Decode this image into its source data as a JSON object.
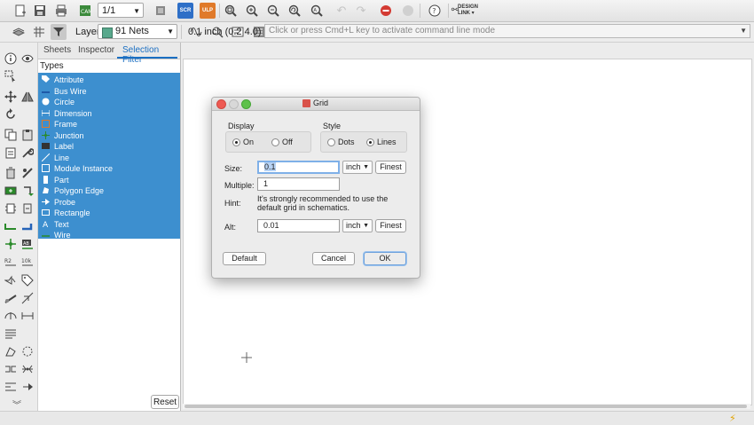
{
  "toolbar": {
    "sheet_value": "1/1",
    "scr_badge": "SCR",
    "ulp_badge": "ULP",
    "design_link_line1": "DESIGN",
    "design_link_line2": "LINK ▾"
  },
  "layer": {
    "label": "Layer:",
    "value": "91 Nets",
    "color": "#58a88c"
  },
  "coords": "0.1 inch (0.2 4.0)",
  "command_line": {
    "placeholder": "Click or press Cmd+L key to activate command line mode"
  },
  "panel": {
    "tabs": [
      "Sheets",
      "Inspector",
      "Selection Filter"
    ],
    "active_tab": "Selection Filter",
    "types_title": "Types",
    "types": [
      {
        "label": "Attribute",
        "icon": "tag-icon"
      },
      {
        "label": "Bus Wire",
        "icon": "bus-wire-icon"
      },
      {
        "label": "Circle",
        "icon": "circle-icon"
      },
      {
        "label": "Dimension",
        "icon": "dimension-icon"
      },
      {
        "label": "Frame",
        "icon": "frame-icon"
      },
      {
        "label": "Junction",
        "icon": "junction-icon"
      },
      {
        "label": "Label",
        "icon": "label-icon"
      },
      {
        "label": "Line",
        "icon": "line-icon"
      },
      {
        "label": "Module Instance",
        "icon": "module-icon"
      },
      {
        "label": "Part",
        "icon": "part-icon"
      },
      {
        "label": "Polygon Edge",
        "icon": "polygon-icon"
      },
      {
        "label": "Probe",
        "icon": "probe-icon"
      },
      {
        "label": "Rectangle",
        "icon": "rectangle-icon"
      },
      {
        "label": "Text",
        "icon": "text-icon"
      },
      {
        "label": "Wire",
        "icon": "wire-icon"
      }
    ],
    "reset_label": "Reset"
  },
  "dialog": {
    "title": "Grid",
    "display_title": "Display",
    "display_options": [
      "On",
      "Off"
    ],
    "display_selected": "On",
    "style_title": "Style",
    "style_options": [
      "Dots",
      "Lines"
    ],
    "style_selected": "Lines",
    "size_label": "Size:",
    "size_value": "0.1",
    "size_unit": "inch",
    "multiple_label": "Multiple:",
    "multiple_value": "1",
    "hint_label": "Hint:",
    "hint_text": "It's strongly recommended to use the default grid in schematics.",
    "alt_label": "Alt:",
    "alt_value": "0.01",
    "alt_unit": "inch",
    "finest_label": "Finest",
    "default_label": "Default",
    "cancel_label": "Cancel",
    "ok_label": "OK"
  }
}
